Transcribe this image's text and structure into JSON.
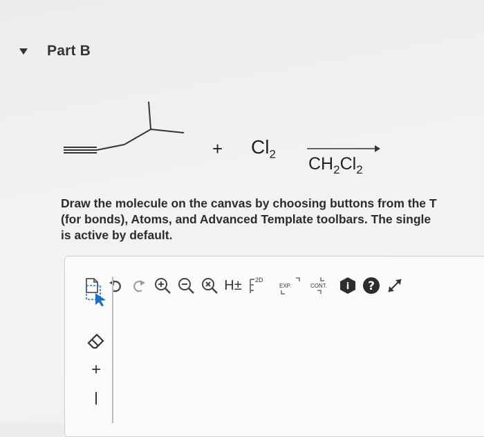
{
  "part": {
    "label": "Part B"
  },
  "reaction": {
    "plus": "+",
    "reagent": {
      "base": "Cl",
      "sub": "2"
    },
    "solvent": {
      "p1": "CH",
      "s1": "2",
      "p2": "Cl",
      "s2": "2"
    }
  },
  "instructions": {
    "line1": "Draw the molecule on the canvas by choosing buttons from the T",
    "line2": "(for bonds), Atoms, and Advanced Template toolbars. The single",
    "line3": "is active by default."
  },
  "toolbar": {
    "hydrogen_label": "H±",
    "twod_label": "2D",
    "exp_label": "EXP.",
    "cont_label": "CONT.",
    "info_label": "i",
    "help_label": "?"
  },
  "left_toolbar": {
    "plus_charge": "+"
  },
  "icons": [
    "caret-down-icon",
    "new-document-icon",
    "undo-icon",
    "redo-icon",
    "zoom-in-icon",
    "zoom-out-icon",
    "clear-zoom-icon",
    "select-icon",
    "eraser-icon",
    "bond-icon",
    "expand-icon"
  ],
  "colors": {
    "accent_blue": "#1f6fc5",
    "text": "#222222"
  }
}
